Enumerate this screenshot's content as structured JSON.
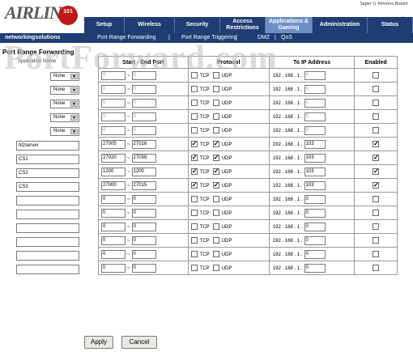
{
  "brand": {
    "logo_text": "AIRLINK",
    "logo_badge": "101",
    "tagline": "networkingsolutions",
    "product_name": "Super G Wireless Router",
    "watermark": "PortForward.com"
  },
  "nav": {
    "tabs": [
      {
        "label": "Setup"
      },
      {
        "label": "Wireless"
      },
      {
        "label": "Security"
      },
      {
        "label": "Access Restrictions"
      },
      {
        "label": "Applications & Gaming",
        "active": true
      },
      {
        "label": "Administration"
      },
      {
        "label": "Status"
      }
    ]
  },
  "subnav": {
    "items": [
      "Port Range Forwarding",
      "Port Range Triggering",
      "DMZ",
      "QoS"
    ],
    "separator": "|"
  },
  "sidebar": {
    "section_title": "Port Range Forwarding",
    "app_column_header": "Application Name",
    "preset_selects": [
      "None",
      "None",
      "None",
      "None",
      "None"
    ],
    "app_names": [
      "hl2server",
      "CS1",
      "CS2",
      "CS3",
      "",
      "",
      "",
      "",
      "",
      ""
    ]
  },
  "table": {
    "headers": {
      "ports": "Start - End Port",
      "protocol": "Protocol",
      "ip": "To IP Address",
      "enabled": "Enabled"
    },
    "tcp_label": "TCP",
    "udp_label": "UDP",
    "ip_prefix": "192 . 168 . 1 .",
    "range_sep": "~",
    "rows": [
      {
        "start": "0",
        "end": "0",
        "tcp": false,
        "udp": false,
        "ip": "0",
        "enabled": false,
        "disabled": true
      },
      {
        "start": "0",
        "end": "0",
        "tcp": false,
        "udp": false,
        "ip": "0",
        "enabled": false,
        "disabled": true
      },
      {
        "start": "0",
        "end": "0",
        "tcp": false,
        "udp": false,
        "ip": "0",
        "enabled": false,
        "disabled": true
      },
      {
        "start": "0",
        "end": "0",
        "tcp": false,
        "udp": false,
        "ip": "0",
        "enabled": false,
        "disabled": true
      },
      {
        "start": "0",
        "end": "0",
        "tcp": false,
        "udp": false,
        "ip": "0",
        "enabled": false,
        "disabled": true
      },
      {
        "start": "27005",
        "end": "27016",
        "tcp": true,
        "udp": true,
        "ip": "103",
        "enabled": true,
        "disabled": false
      },
      {
        "start": "27020",
        "end": "27039",
        "tcp": true,
        "udp": true,
        "ip": "103",
        "enabled": true,
        "disabled": false
      },
      {
        "start": "1200",
        "end": "1200",
        "tcp": true,
        "udp": true,
        "ip": "103",
        "enabled": true,
        "disabled": false
      },
      {
        "start": "27000",
        "end": "27015",
        "tcp": true,
        "udp": true,
        "ip": "103",
        "enabled": true,
        "disabled": false
      },
      {
        "start": "0",
        "end": "0",
        "tcp": false,
        "udp": false,
        "ip": "0",
        "enabled": false,
        "disabled": false
      },
      {
        "start": "0",
        "end": "0",
        "tcp": false,
        "udp": false,
        "ip": "0",
        "enabled": false,
        "disabled": false
      },
      {
        "start": "0",
        "end": "0",
        "tcp": false,
        "udp": false,
        "ip": "0",
        "enabled": false,
        "disabled": false
      },
      {
        "start": "0",
        "end": "0",
        "tcp": false,
        "udp": false,
        "ip": "0",
        "enabled": false,
        "disabled": false
      },
      {
        "start": "0",
        "end": "0",
        "tcp": false,
        "udp": false,
        "ip": "0",
        "enabled": false,
        "disabled": false
      },
      {
        "start": "0",
        "end": "0",
        "tcp": false,
        "udp": false,
        "ip": "0",
        "enabled": false,
        "disabled": false
      }
    ]
  },
  "buttons": {
    "apply": "Apply",
    "cancel": "Cancel"
  },
  "colors": {
    "nav_bg": "#1f3d73",
    "active_tab": "#6e8fc6",
    "brand_red": "#c01818"
  }
}
